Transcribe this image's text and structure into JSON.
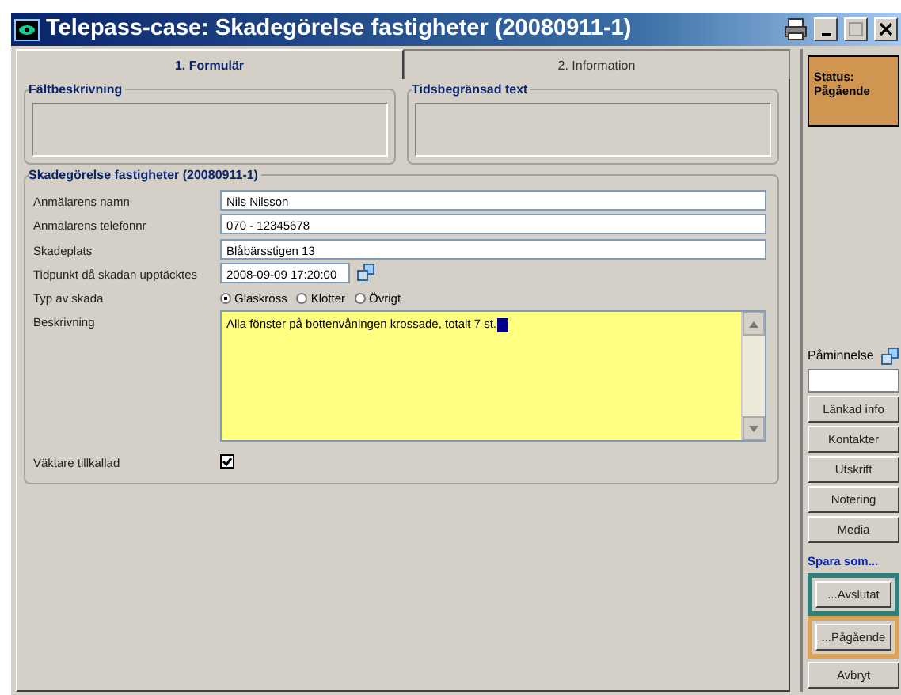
{
  "window": {
    "title": "Telepass-case: Skadegörelse fastigheter (20080911-1)"
  },
  "tabs": [
    {
      "label": "1. Formulär",
      "selected": true
    },
    {
      "label": "2. Information",
      "selected": false
    }
  ],
  "info_groups": [
    {
      "title": "Fältbeskrivning"
    },
    {
      "title": "Tidsbegränsad text"
    }
  ],
  "form": {
    "title": "Skadegörelse fastigheter (20080911-1)",
    "fields": [
      {
        "kind": "text",
        "label": "Anmälarens namn",
        "value": "Nils Nilsson"
      },
      {
        "kind": "text",
        "label": "Anmälarens telefonnr",
        "value": "070 - 12345678"
      },
      {
        "kind": "text",
        "label": "Skadeplats",
        "value": "Blåbärsstigen 13"
      },
      {
        "kind": "datetime",
        "label": "Tidpunkt då skadan upptäcktes",
        "value": "2008-09-09 17:20:00"
      },
      {
        "kind": "radio",
        "label": "Typ av skada",
        "options": [
          {
            "label": "Glaskross",
            "selected": true
          },
          {
            "label": "Klotter",
            "selected": false
          },
          {
            "label": "Övrigt",
            "selected": false
          }
        ]
      },
      {
        "kind": "textarea",
        "label": "Beskrivning",
        "value": "Alla fönster på bottenvåningen krossade, totalt 7 st."
      },
      {
        "kind": "checkbox",
        "label": "Väktare tillkallad",
        "checked": true
      }
    ]
  },
  "sidebar": {
    "status": "Status: Pågående",
    "reminder_label": "Påminnelse",
    "buttons": [
      "Länkad info",
      "Kontakter",
      "Utskrift",
      "Notering",
      "Media"
    ],
    "save_as_label": "Spara som...",
    "save_buttons": [
      {
        "label": "...Avslutat",
        "color": "#2f7f7a"
      },
      {
        "label": "...Pågående",
        "color": "#d9a35a"
      }
    ],
    "cancel": "Avbryt"
  }
}
